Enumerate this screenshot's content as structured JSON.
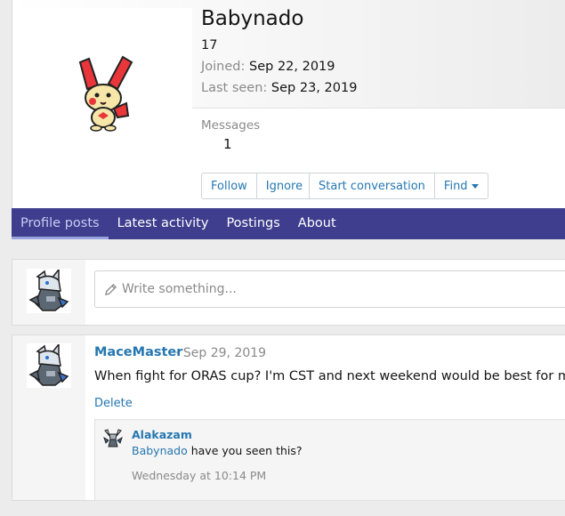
{
  "profile": {
    "username": "Babynado",
    "message_count_line": "17",
    "joined_label": "Joined:",
    "joined_value": "Sep 22, 2019",
    "last_seen_label": "Last seen:",
    "last_seen_value": "Sep 23, 2019",
    "messages_label": "Messages",
    "messages_value": "1",
    "avatar_icon": "plusle-sprite-icon"
  },
  "actions": {
    "follow": "Follow",
    "ignore": "Ignore",
    "start_conversation": "Start conversation",
    "find": "Find"
  },
  "tabs": [
    {
      "label": "Profile posts",
      "active": true
    },
    {
      "label": "Latest activity",
      "active": false
    },
    {
      "label": "Postings",
      "active": false
    },
    {
      "label": "About",
      "active": false
    }
  ],
  "composer": {
    "placeholder": "Write something...",
    "avatar_icon": "aggron-sprite-icon"
  },
  "post": {
    "author": "MaceMaster",
    "date": "Sep 29, 2019",
    "separator": "·",
    "body": "When fight for ORAS cup? I'm CST and next weekend would be best for me",
    "delete_label": "Delete",
    "avatar_icon": "aggron-sprite-icon"
  },
  "comment": {
    "author": "Alakazam",
    "mention": "Babynado",
    "text": " have you seen this?",
    "time": "Wednesday at 10:14 PM",
    "avatar_icon": "alakazam-sprite-icon"
  },
  "colors": {
    "accent_link": "#2577b1",
    "tabbar_bg": "#3e3d8e",
    "active_tab_text": "#c7cdf2"
  }
}
